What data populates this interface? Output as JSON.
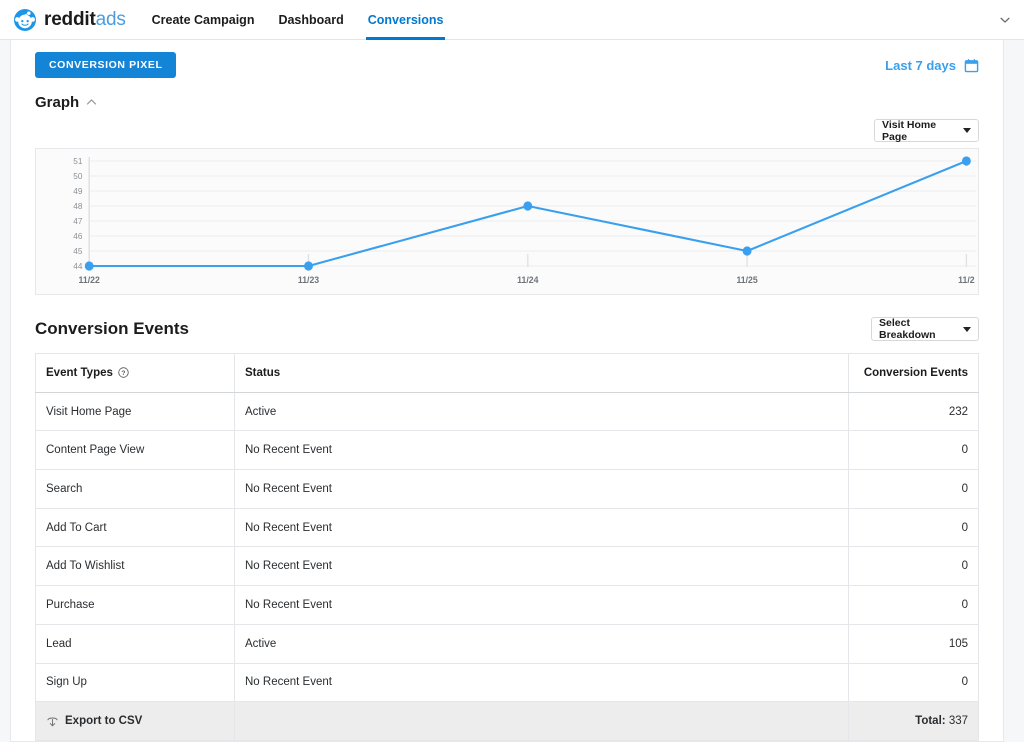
{
  "navbar": {
    "brand_primary": "reddit",
    "brand_secondary": "ads",
    "logo_icon": "reddit-snoo-icon",
    "links": [
      {
        "label": "Create Campaign",
        "active": false
      },
      {
        "label": "Dashboard",
        "active": false
      },
      {
        "label": "Conversions",
        "active": true
      }
    ],
    "account_caret_icon": "chevron-down-icon"
  },
  "toolbar": {
    "conversion_pixel_label": "CONVERSION PIXEL",
    "date_range_label": "Last 7 days",
    "calendar_icon": "calendar-icon",
    "accent_color": "#1484d6",
    "link_color": "#3aa0ee"
  },
  "graph": {
    "title": "Graph",
    "collapse_icon": "chevron-up-icon",
    "event_select_value": "Visit Home Page",
    "select_caret_icon": "caret-down-icon"
  },
  "chart_data": {
    "type": "line",
    "title": "",
    "xlabel": "",
    "ylabel": "",
    "x": [
      "11/22",
      "11/23",
      "11/24",
      "11/25",
      "11/2"
    ],
    "categories": [
      "11/22",
      "11/23",
      "11/24",
      "11/25",
      "11/2"
    ],
    "values": [
      44,
      44,
      48,
      45,
      51
    ],
    "series": [
      {
        "name": "Visit Home Page",
        "values": [
          44,
          44,
          48,
          45,
          51
        ]
      }
    ],
    "yticks": [
      51,
      50,
      49,
      48,
      47,
      46,
      45,
      44
    ],
    "ylim": [
      44,
      51
    ],
    "grid": true,
    "legend": "none",
    "line_color": "#3aa0ee",
    "point_color": "#3aa0ee",
    "plot_background": "#fbfbfb"
  },
  "conversion_events": {
    "title": "Conversion Events",
    "breakdown_value": "Select Breakdown",
    "breakdown_caret_icon": "caret-down-icon",
    "columns": {
      "event_types": "Event Types",
      "event_types_info_icon": "info-question-icon",
      "status": "Status",
      "conversion_events": "Conversion Events"
    },
    "rows": [
      {
        "type": "Visit Home Page",
        "status": "Active",
        "conversions": "232"
      },
      {
        "type": "Content Page View",
        "status": "No Recent Event",
        "conversions": "0"
      },
      {
        "type": "Search",
        "status": "No Recent Event",
        "conversions": "0"
      },
      {
        "type": "Add To Cart",
        "status": "No Recent Event",
        "conversions": "0"
      },
      {
        "type": "Add To Wishlist",
        "status": "No Recent Event",
        "conversions": "0"
      },
      {
        "type": "Purchase",
        "status": "No Recent Event",
        "conversions": "0"
      },
      {
        "type": "Lead",
        "status": "Active",
        "conversions": "105"
      },
      {
        "type": "Sign Up",
        "status": "No Recent Event",
        "conversions": "0"
      }
    ],
    "footer": {
      "export_label": "Export to CSV",
      "export_icon": "upload-arrow-icon",
      "total_label": "Total:",
      "total_value": "337"
    }
  }
}
